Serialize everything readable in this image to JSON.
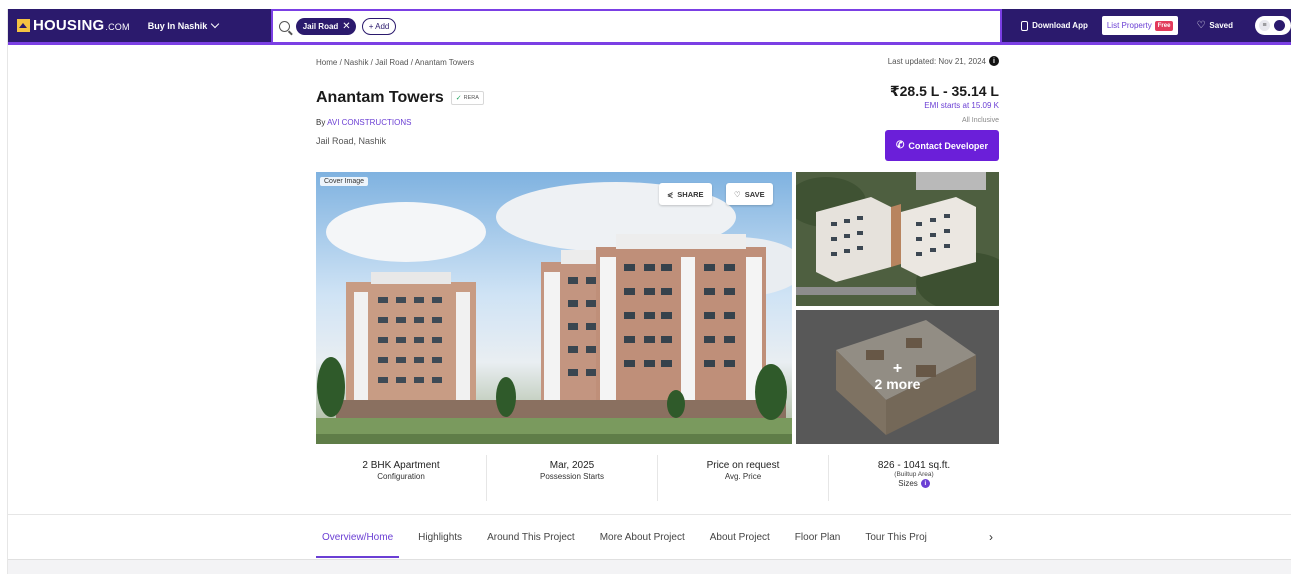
{
  "header": {
    "logo_text": "HOUSING",
    "logo_suffix": ".COM",
    "city_selector": "Buy In Nashik",
    "search_chip": "Jail Road",
    "add_chip": "+ Add",
    "download_app": "Download App",
    "list_property": "List Property",
    "free_badge": "Free",
    "saved": "Saved"
  },
  "breadcrumb": "Home / Nashik / Jail Road / Anantam Towers",
  "last_updated": "Last updated: Nov 21, 2024",
  "project": {
    "title": "Anantam Towers",
    "rera_badge": "RERA",
    "by_prefix": "By ",
    "developer": "AVI CONSTRUCTIONS",
    "location": "Jail Road, Nashik"
  },
  "pricing": {
    "range": "₹28.5 L - 35.14 L",
    "emi": "EMI starts at  15.09 K",
    "inclusive": "All Inclusive",
    "contact_button": "Contact Developer"
  },
  "gallery": {
    "cover_label": "Cover Image",
    "share": "SHARE",
    "save": "SAVE",
    "more_plus": "+",
    "more_text": "2 more"
  },
  "info": [
    {
      "value": "2 BHK Apartment",
      "label": "Configuration"
    },
    {
      "value": "Mar, 2025",
      "label": "Possession Starts"
    },
    {
      "value": "Price on request",
      "label": "Avg. Price"
    },
    {
      "value": "826 - 1041 sq.ft.",
      "sub": "(Builtup Area)",
      "label": "Sizes"
    }
  ],
  "tabs": [
    "Overview/Home",
    "Highlights",
    "Around This Project",
    "More About Project",
    "About Project",
    "Floor Plan",
    "Tour This Proj"
  ],
  "colors": {
    "brand": "#2b1a6d",
    "accent": "#6b1fd9",
    "free": "#e23a5b"
  }
}
